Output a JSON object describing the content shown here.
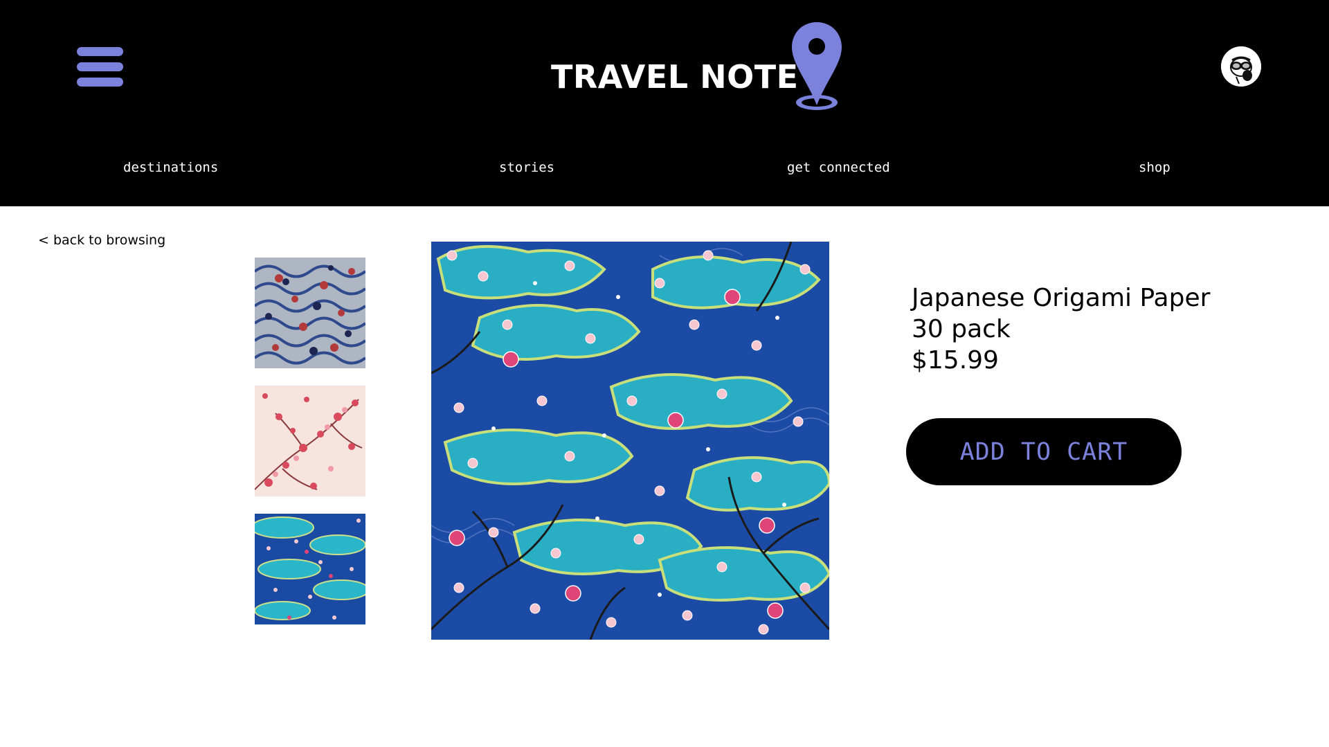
{
  "brand": {
    "name": "TRAVEL NOTE",
    "pin_color": "#7b82db"
  },
  "header": {
    "background": "#000000",
    "menu_icon": "hamburger-menu-icon",
    "avatar_icon": "profile-avatar-icon"
  },
  "nav": {
    "items": [
      {
        "label": "destinations"
      },
      {
        "label": "stories"
      },
      {
        "label": "get connected"
      },
      {
        "label": "shop"
      }
    ]
  },
  "back_link": {
    "label": "< back to browsing"
  },
  "gallery": {
    "thumbnails": [
      {
        "name": "blue-waves-floral-pattern"
      },
      {
        "name": "pink-plum-blossom-pattern"
      },
      {
        "name": "teal-clouds-sakura-pattern"
      }
    ],
    "main_image": "teal-clouds-sakura-pattern"
  },
  "product": {
    "title_line1": "Japanese Origami Paper",
    "title_line2": "30 pack",
    "price": "$15.99",
    "add_to_cart_label": "ADD TO CART"
  },
  "colors": {
    "accent": "#7b82db",
    "button_bg": "#000000"
  }
}
